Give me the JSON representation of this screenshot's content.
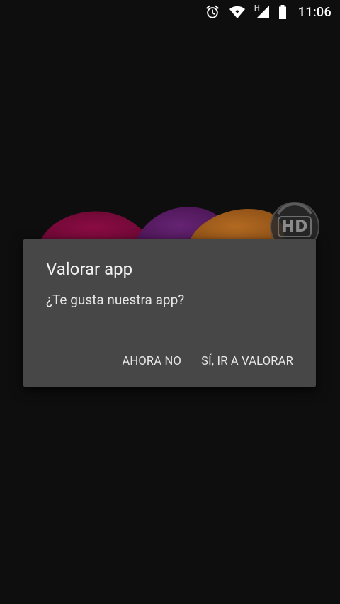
{
  "status_bar": {
    "time": "11:06",
    "network_type": "H",
    "icons": [
      "alarm-icon",
      "wifi-icon",
      "signal-icon",
      "battery-icon"
    ]
  },
  "background": {
    "badge_text": "HD",
    "colors": {
      "magenta": "#7d0a3c",
      "purple": "#5a1c66",
      "orange": "#a8631e"
    }
  },
  "dialog": {
    "title": "Valorar app",
    "message": "¿Te gusta nuestra app?",
    "buttons": {
      "negative": "AHORA NO",
      "positive": "SÍ, IR A VALORAR"
    },
    "colors": {
      "surface": "#474747",
      "text": "#ffffff"
    }
  }
}
